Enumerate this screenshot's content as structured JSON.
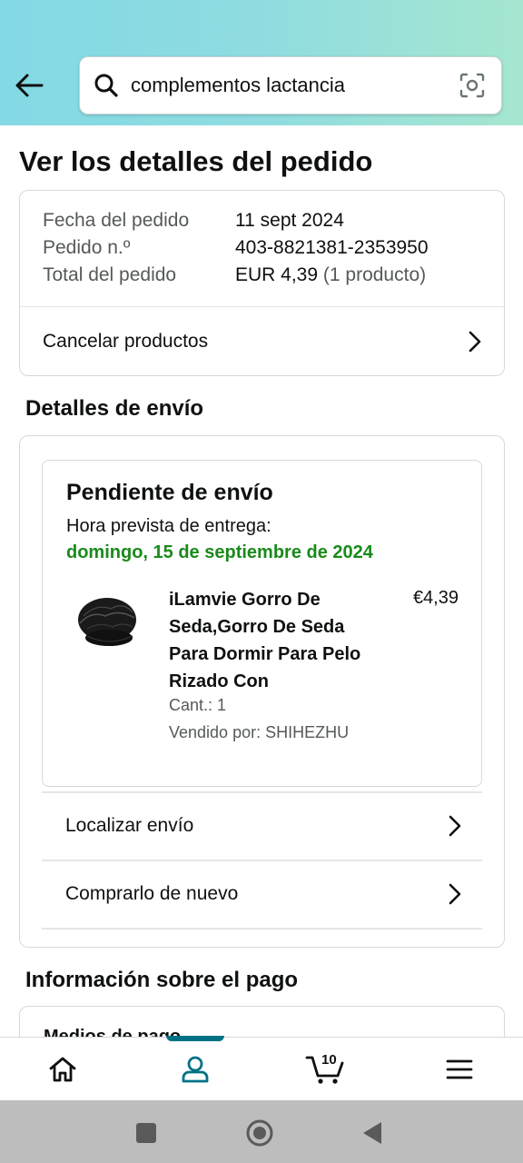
{
  "search": {
    "query": "complementos lactancia",
    "back_icon": "arrow-left-icon",
    "search_icon": "search-icon",
    "camera_icon": "camera-lens-icon"
  },
  "page_title": "Ver los detalles del pedido",
  "order_summary": {
    "rows": [
      {
        "label": "Fecha del pedido",
        "value": "11 sept 2024",
        "extra": ""
      },
      {
        "label": "Pedido n.º",
        "value": "403-8821381-2353950",
        "extra": ""
      },
      {
        "label": "Total del pedido",
        "value": "EUR 4,39",
        "extra": "(1 producto)"
      }
    ],
    "cancel_label": "Cancelar productos"
  },
  "shipping": {
    "section_title": "Detalles de envío",
    "status": "Pendiente de envío",
    "eta_label": "Hora prevista de entrega:",
    "eta_date": "domingo, 15 de septiembre de 2024",
    "eta_color": "#1a8a1a",
    "product": {
      "title": "iLamvie Gorro De Seda,Gorro De Seda Para Dormir Para Pelo Rizado Con",
      "price": "€4,39",
      "quantity": "Cant.: 1",
      "seller": "Vendido por: SHIHEZHU"
    },
    "track_label": "Localizar envío",
    "buy_again_label": "Comprarlo de nuevo"
  },
  "payment": {
    "section_title": "Información sobre el pago",
    "method_label": "Medios de pago"
  },
  "bottom_nav": {
    "items": [
      {
        "icon": "home-icon"
      },
      {
        "icon": "user-icon",
        "active": true
      },
      {
        "icon": "cart-icon",
        "badge": "10"
      },
      {
        "icon": "menu-icon"
      }
    ],
    "accent": "#007185"
  },
  "system_nav": {
    "items": [
      "recents-square-icon",
      "home-circle-icon",
      "back-triangle-icon"
    ]
  }
}
